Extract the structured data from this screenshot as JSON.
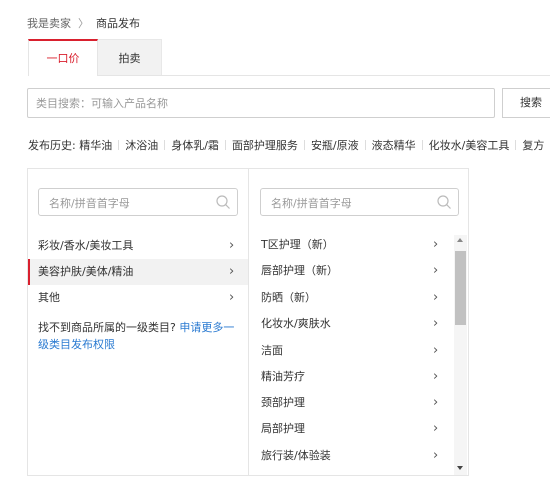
{
  "breadcrumb": {
    "root": "我是卖家",
    "separator": "〉",
    "current": "商品发布"
  },
  "tabs": [
    {
      "label": "一口价"
    },
    {
      "label": "拍卖"
    }
  ],
  "search": {
    "placeholder": "类目搜索：可输入产品名称",
    "value": "",
    "button": "搜索"
  },
  "history": {
    "label": "发布历史:",
    "items": [
      "精华油",
      "沐浴油",
      "身体乳/霜",
      "面部护理服务",
      "安瓶/原液",
      "液态精华",
      "化妆水/美容工具",
      "复方"
    ]
  },
  "level1": {
    "filter_placeholder": "名称/拼音首字母",
    "items": [
      {
        "label": "彩妆/香水/美妆工具",
        "selected": false
      },
      {
        "label": "美容护肤/美体/精油",
        "selected": true
      },
      {
        "label": "其他",
        "selected": false
      }
    ],
    "hint_text": "找不到商品所属的一级类目? ",
    "hint_link": "申请更多一级类目发布权限"
  },
  "level2": {
    "filter_placeholder": "名称/拼音首字母",
    "items": [
      {
        "label": "T区护理（新）"
      },
      {
        "label": "唇部护理（新）"
      },
      {
        "label": "防晒（新）"
      },
      {
        "label": "化妆水/爽肤水"
      },
      {
        "label": "洁面"
      },
      {
        "label": "精油芳疗"
      },
      {
        "label": "颈部护理"
      },
      {
        "label": "局部护理"
      },
      {
        "label": "旅行装/体验装"
      }
    ]
  },
  "icons": {
    "chevron": "chevron-right-icon",
    "search": "search-icon"
  },
  "colors": {
    "accent": "#d9202e",
    "link": "#2a7ad1"
  }
}
